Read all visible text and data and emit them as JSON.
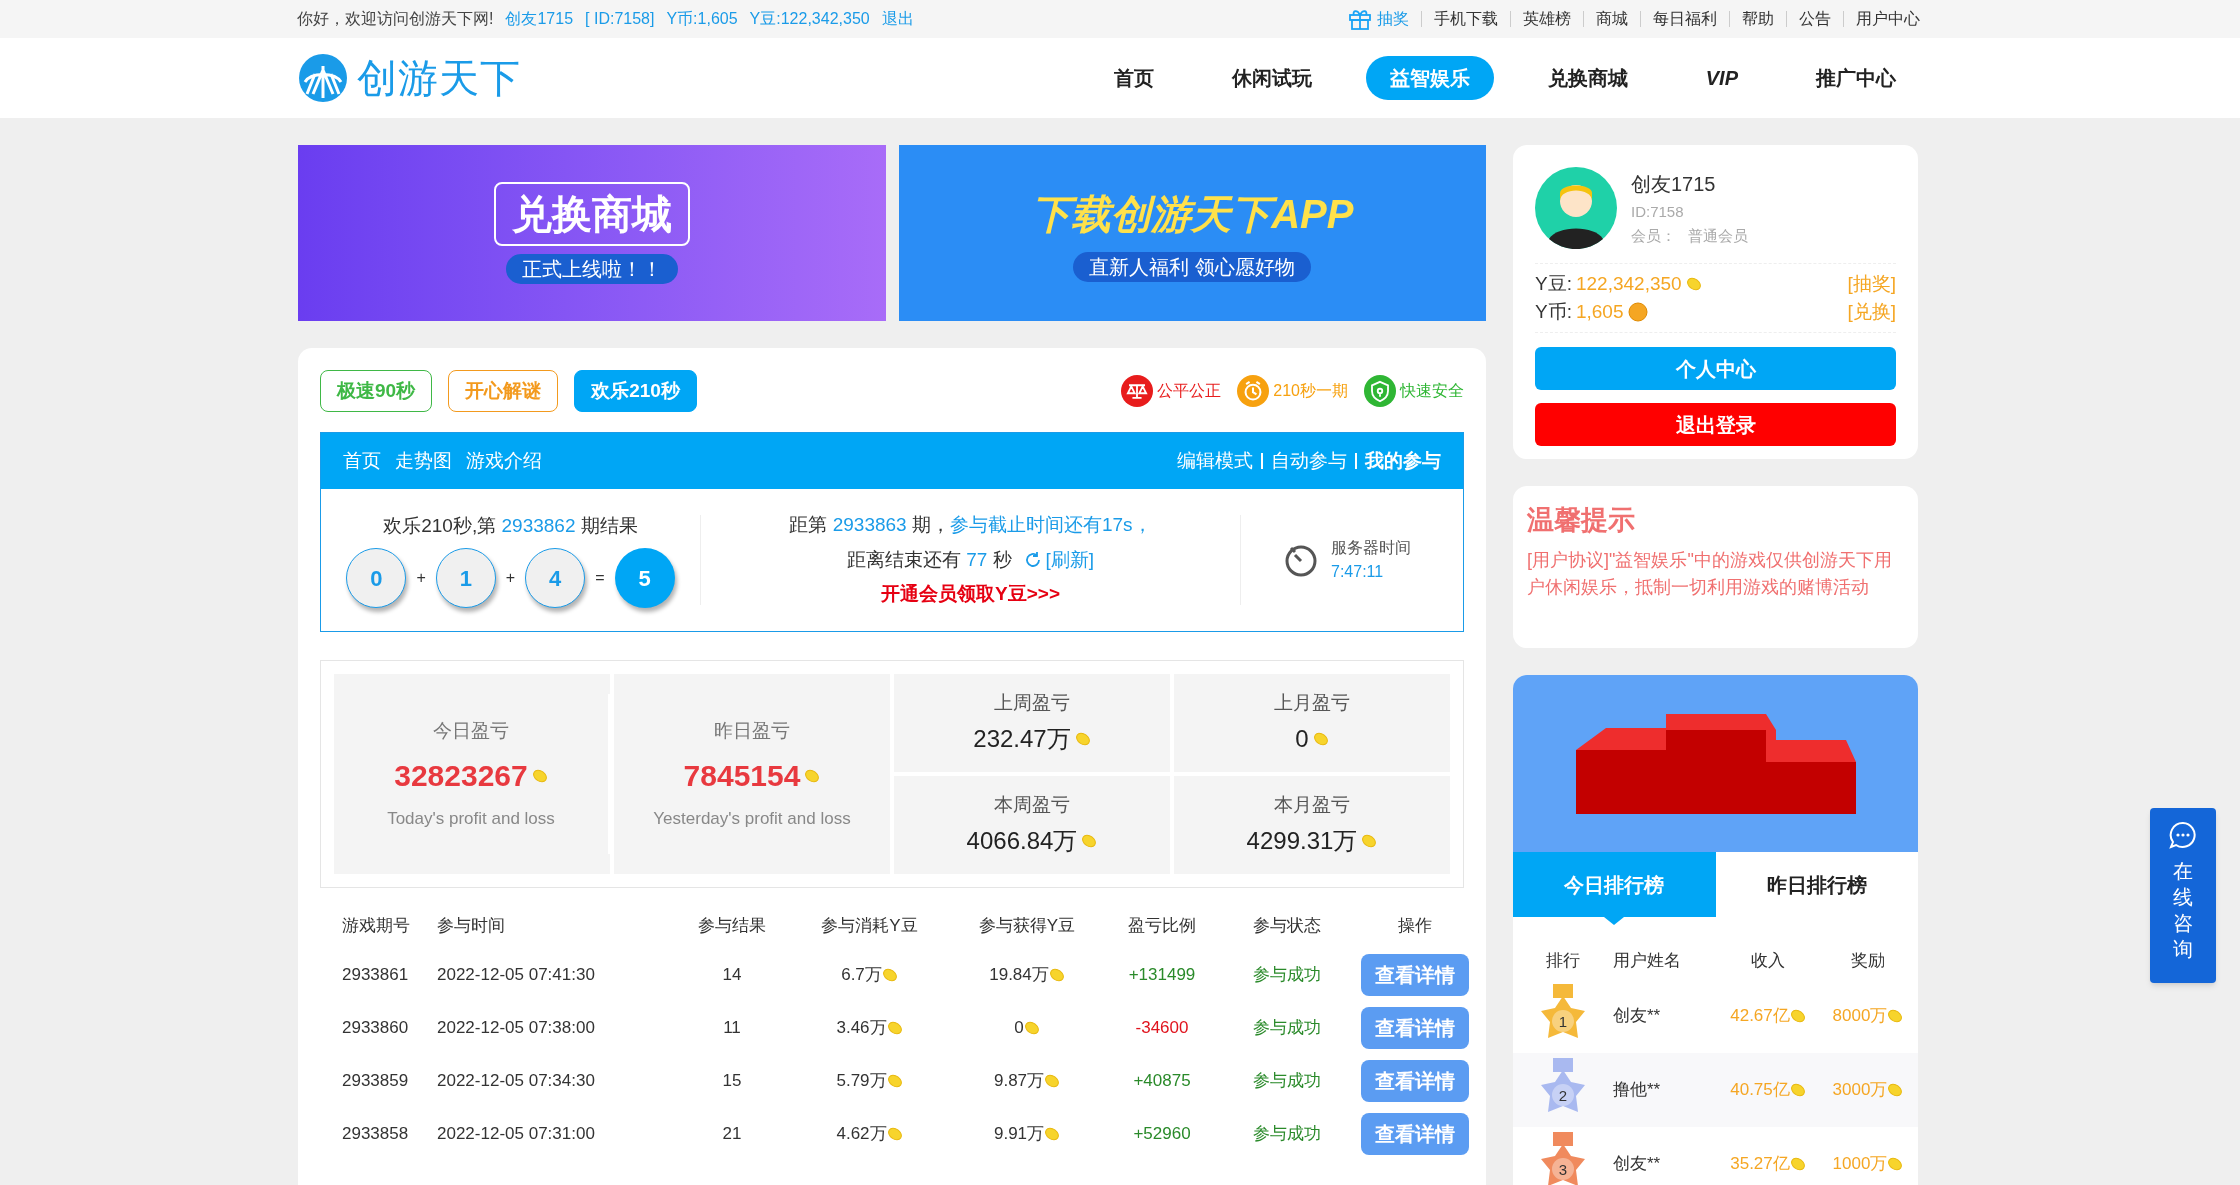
{
  "top_bar": {
    "greeting": "你好，欢迎访问创游天下网!",
    "user_links": [
      "创友1715",
      "[ ID:7158]",
      "Y币:1,605",
      "Y豆:122,342,350",
      "退出"
    ],
    "right_links": [
      {
        "label": "抽奖",
        "kind": "gift"
      },
      {
        "label": "手机下载",
        "kind": "plain"
      },
      {
        "label": "英雄榜",
        "kind": "plain"
      },
      {
        "label": "商城",
        "kind": "plain"
      },
      {
        "label": "每日福利",
        "kind": "plain"
      },
      {
        "label": "帮助",
        "kind": "plain"
      },
      {
        "label": "公告",
        "kind": "plain"
      },
      {
        "label": "用户中心",
        "kind": "plain"
      }
    ]
  },
  "header": {
    "logo_text": "创游天下",
    "nav": [
      {
        "label": "首页",
        "kind": "text",
        "selected": false
      },
      {
        "label": "休闲试玩",
        "kind": "text",
        "selected": false
      },
      {
        "label": "益智娱乐",
        "kind": "text",
        "selected": true
      },
      {
        "label": "兑换商城",
        "kind": "text",
        "selected": false
      },
      {
        "label": "VIP",
        "kind": "vip",
        "selected": false
      },
      {
        "label": "推广中心",
        "kind": "text",
        "selected": false
      }
    ]
  },
  "banners": [
    {
      "title": "兑换商城",
      "subtitle": "正式上线啦！！",
      "kind": "mall"
    },
    {
      "title": "下载创游天下APP",
      "subtitle": "直新人福利  领心愿好物",
      "kind": "app"
    }
  ],
  "game_tabs": [
    {
      "label": "极速90秒",
      "color": "#3fb846",
      "selected": false
    },
    {
      "label": "开心解谜",
      "color": "#f39a1e",
      "selected": false
    },
    {
      "label": "欢乐210秒",
      "color": "#00a6f5",
      "selected": true
    }
  ],
  "features": [
    {
      "label": "公平公正",
      "kind": "scale",
      "color": "#e81c1c"
    },
    {
      "label": "210秒一期",
      "kind": "clock",
      "color": "#f7a10f"
    },
    {
      "label": "快速安全",
      "kind": "shield",
      "color": "#2fb634"
    }
  ],
  "panel": {
    "left_nav": [
      "首页",
      "走势图",
      "游戏介绍"
    ],
    "right_nav": [
      {
        "label": "编辑模式",
        "selected": false
      },
      {
        "label": "自动参与",
        "selected": false
      },
      {
        "label": "我的参与",
        "selected": true
      }
    ],
    "result": {
      "prefix": "欢乐210秒,第 ",
      "issue": "2933862",
      "suffix": " 期结果",
      "items": [
        {
          "kind": "ball",
          "text": "0"
        },
        {
          "kind": "op",
          "text": "+"
        },
        {
          "kind": "ball",
          "text": "1"
        },
        {
          "kind": "op",
          "text": "+"
        },
        {
          "kind": "ball",
          "text": "4"
        },
        {
          "kind": "op",
          "text": "="
        },
        {
          "kind": "sum",
          "text": "5"
        }
      ]
    },
    "countdown": {
      "prefix": "距第 ",
      "issue": "2933863",
      "mid": " 期，",
      "deadline": "参与截止时间还有17s，",
      "end_prefix": "距离结束还有 ",
      "seconds": "77",
      "end_suffix": " 秒",
      "refresh": "[刷新]",
      "promo": "开通会员领取Y豆>>>"
    },
    "server_time": {
      "label": "服务器时间",
      "value": "7:47:11"
    }
  },
  "stats": {
    "big": [
      {
        "label": "今日盈亏",
        "value": "32823267",
        "caption": "Today's profit and loss"
      },
      {
        "label": "昨日盈亏",
        "value": "7845154",
        "caption": "Yesterday's profit and loss"
      }
    ],
    "small": [
      {
        "label": "上周盈亏",
        "value": "232.47万"
      },
      {
        "label": "上月盈亏",
        "value": "0"
      },
      {
        "label": "本周盈亏",
        "value": "4066.84万"
      },
      {
        "label": "本月盈亏",
        "value": "4299.31万"
      }
    ]
  },
  "history": {
    "columns": [
      "游戏期号",
      "参与时间",
      "参与结果",
      "参与消耗Y豆",
      "参与获得Y豆",
      "盈亏比例",
      "参与状态",
      "操作"
    ],
    "rows": [
      {
        "issue": "2933861",
        "time": "2022-12-05 07:41:30",
        "result": "14",
        "cost": "6.7万",
        "gain": "19.84万",
        "ratio": "+131499",
        "kind": "profit",
        "status": "参与成功",
        "action": "查看详情"
      },
      {
        "issue": "2933860",
        "time": "2022-12-05 07:38:00",
        "result": "11",
        "cost": "3.46万",
        "gain": "0",
        "ratio": "-34600",
        "kind": "loss",
        "status": "参与成功",
        "action": "查看详情"
      },
      {
        "issue": "2933859",
        "time": "2022-12-05 07:34:30",
        "result": "15",
        "cost": "5.79万",
        "gain": "9.87万",
        "ratio": "+40875",
        "kind": "profit",
        "status": "参与成功",
        "action": "查看详情"
      },
      {
        "issue": "2933858",
        "time": "2022-12-05 07:31:00",
        "result": "21",
        "cost": "4.62万",
        "gain": "9.91万",
        "ratio": "+52960",
        "kind": "profit",
        "status": "参与成功",
        "action": "查看详情"
      }
    ]
  },
  "user": {
    "name": "创友1715",
    "id": "ID:7158",
    "member_label": "会员：",
    "member_level": "普通会员",
    "balances": [
      {
        "label": "Y豆:",
        "value": "122,342,350",
        "kind": "bean",
        "action": "[抽奖]"
      },
      {
        "label": "Y币:",
        "value": "1,605",
        "kind": "coin",
        "action": "[兑换]"
      }
    ],
    "buttons": [
      {
        "label": "个人中心",
        "kind": "primary"
      },
      {
        "label": "退出登录",
        "kind": "danger"
      }
    ]
  },
  "tips": {
    "title": "温馨提示",
    "text": "[用户协议]\"益智娱乐\"中的游戏仅供创游天下用户休闲娱乐，抵制一切利用游戏的赌博活动"
  },
  "ranking": {
    "tabs": [
      {
        "label": "今日排行榜",
        "selected": true
      },
      {
        "label": "昨日排行榜",
        "selected": false
      }
    ],
    "columns": [
      "排行",
      "用户姓名",
      "收入",
      "奖励"
    ],
    "rows": [
      {
        "rank": "1",
        "color": "#f5b93a",
        "name": "创友**",
        "income": "42.67亿",
        "reward": "8000万"
      },
      {
        "rank": "2",
        "color": "#a9b9f0",
        "name": "撸他**",
        "income": "40.75亿",
        "reward": "3000万"
      },
      {
        "rank": "3",
        "color": "#f08a5d",
        "name": "创友**",
        "income": "35.27亿",
        "reward": "1000万"
      }
    ]
  },
  "consult": {
    "label": "在线咨询"
  }
}
